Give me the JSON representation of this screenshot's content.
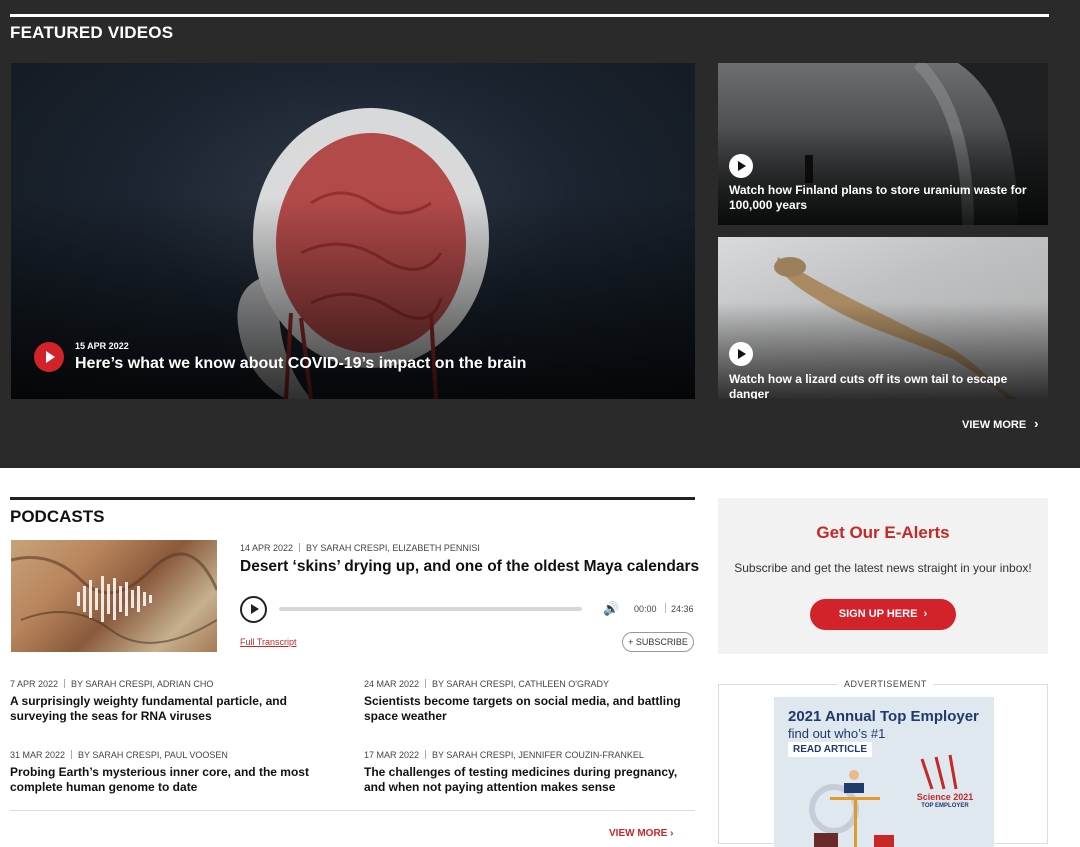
{
  "featured": {
    "title": "FEATURED VIDEOS",
    "main": {
      "date": "15 APR 2022",
      "title": "Here’s what we know about COVID-19’s impact on the brain"
    },
    "side": [
      {
        "title": "Watch how Finland plans to store uranium waste for 100,000 years"
      },
      {
        "title": "Watch how a lizard cuts off its own tail to escape danger"
      }
    ],
    "view_more": "VIEW MORE"
  },
  "podcasts": {
    "title": "PODCASTS",
    "featured": {
      "date": "14 APR 2022",
      "authors": "BY SARAH CRESPI, ELIZABETH PENNISI",
      "title": "Desert ‘skins’ drying up, and one of the oldest Maya calendars",
      "current_time": "00:00",
      "duration": "24:36",
      "transcript": "Full Transcript",
      "subscribe": "+ SUBSCRIBE"
    },
    "episodes": [
      {
        "date": "7 APR 2022",
        "authors": "BY SARAH CRESPI, ADRIAN CHO",
        "title": "A surprisingly weighty fundamental particle, and surveying the seas for RNA viruses"
      },
      {
        "date": "24 MAR 2022",
        "authors": "BY SARAH CRESPI, CATHLEEN O'GRADY",
        "title": "Scientists become targets on social media, and battling space weather"
      },
      {
        "date": "31 MAR 2022",
        "authors": "BY SARAH CRESPI, PAUL VOOSEN",
        "title": "Probing Earth’s mysterious inner core, and the most complete human genome to date"
      },
      {
        "date": "17 MAR 2022",
        "authors": "BY SARAH CRESPI, JENNIFER COUZIN-FRANKEL",
        "title": "The challenges of testing medicines during pregnancy, and when not paying attention makes sense"
      }
    ],
    "view_more": "VIEW MORE"
  },
  "alerts": {
    "title": "Get Our E-Alerts",
    "text": "Subscribe and get the latest news straight in your inbox!",
    "button": "SIGN UP HERE"
  },
  "ad": {
    "label": "ADVERTISEMENT",
    "line1": "2021 Annual Top Employer",
    "line2": "find out who’s #1",
    "read": "READ ARTICLE",
    "brand": "Science 2021",
    "brand_sub": "TOP EMPLOYER"
  },
  "colors": {
    "accent_red": "#d2232a",
    "dark_bg": "#2a2a2a",
    "navy": "#1f3a6b"
  }
}
